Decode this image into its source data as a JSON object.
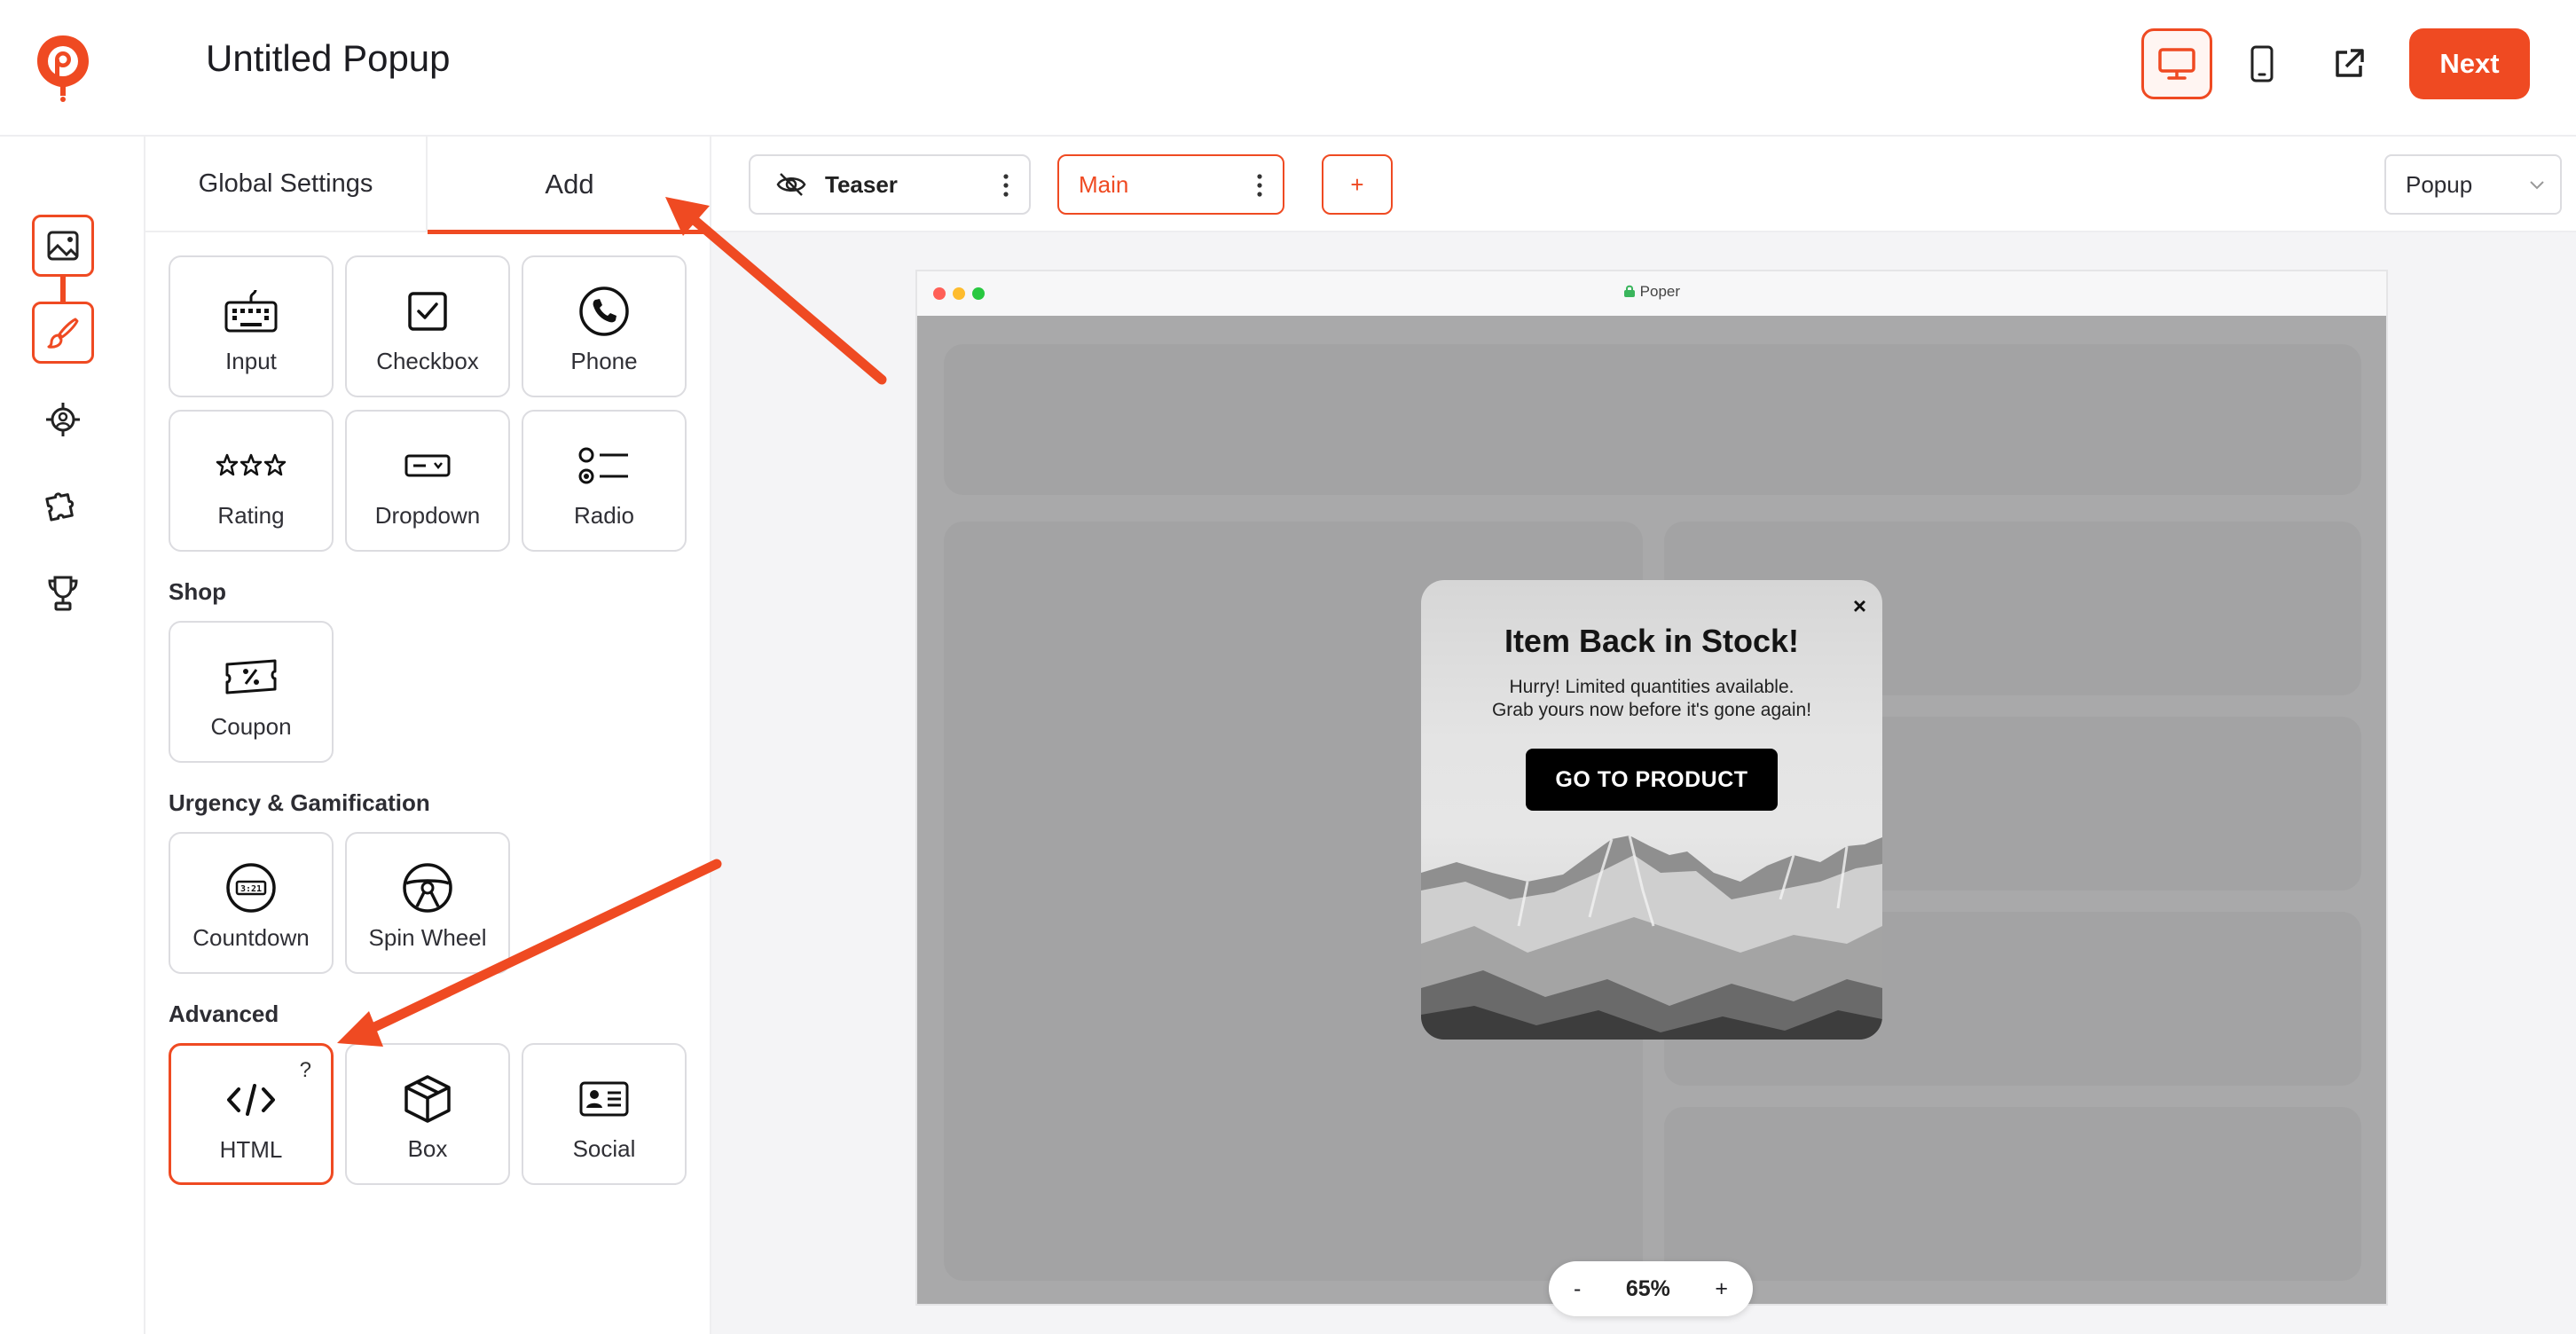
{
  "header": {
    "title": "Untitled Popup",
    "next_label": "Next",
    "accent": "#ef4a22",
    "logo_letter": "p"
  },
  "rail": {
    "items": [
      "image-icon",
      "brush-icon",
      "target-icon",
      "puzzle-icon",
      "trophy-icon"
    ]
  },
  "panel": {
    "tabs": [
      "Global Settings",
      "Add"
    ],
    "form_elements": [
      "Input",
      "Checkbox",
      "Phone",
      "Rating",
      "Dropdown",
      "Radio"
    ],
    "shop": {
      "heading": "Shop",
      "items": [
        "Coupon"
      ]
    },
    "urgency": {
      "heading": "Urgency & Gamification",
      "items": [
        "Countdown",
        "Spin Wheel"
      ]
    },
    "advanced": {
      "heading": "Advanced",
      "items": [
        "HTML",
        "Box",
        "Social"
      ],
      "help_mark": "?"
    }
  },
  "toolbar": {
    "steps": [
      "Teaser",
      "Main"
    ],
    "add_label": "+",
    "type_value": "Popup"
  },
  "preview": {
    "url": "Poper",
    "popup": {
      "close": "×",
      "title": "Item Back in Stock!",
      "subtitle_line1": "Hurry! Limited quantities available.",
      "subtitle_line2": "Grab yours now before it's gone again!",
      "cta": "GO TO PRODUCT"
    }
  },
  "zoom": {
    "minus": "-",
    "value": "65%",
    "plus": "+"
  }
}
